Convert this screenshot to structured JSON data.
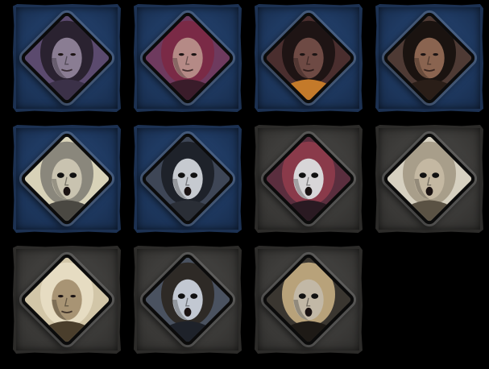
{
  "roster": [
    {
      "name": "character-portrait-1",
      "state": "unlocked",
      "bg": "#5b4a6e",
      "hair": "#2a2230",
      "skin": "#8a7d93",
      "mask": false,
      "accent": "#3b3148",
      "icon": "hooded-woman-icon"
    },
    {
      "name": "character-portrait-2",
      "state": "unlocked",
      "bg": "#6e3a5e",
      "hair": "#7a2a46",
      "skin": "#b58a86",
      "mask": false,
      "accent": "#3a1c2a",
      "icon": "long-hair-man-icon"
    },
    {
      "name": "character-portrait-3",
      "state": "unlocked",
      "bg": "#4a2e2e",
      "hair": "#1e1414",
      "skin": "#6e4a44",
      "mask": false,
      "accent": "#c47a2a",
      "icon": "demon-man-icon"
    },
    {
      "name": "character-portrait-4",
      "state": "unlocked",
      "bg": "#4e3a34",
      "hair": "#1a1310",
      "skin": "#8a6450",
      "mask": false,
      "accent": "#2a1e18",
      "icon": "bearded-brute-icon"
    },
    {
      "name": "character-portrait-5",
      "state": "unlocked",
      "bg": "#d8d2b8",
      "hair": "#8a877c",
      "skin": "#c9c3b0",
      "mask": true,
      "accent": "#4a4842",
      "icon": "screaming-mask-icon"
    },
    {
      "name": "character-portrait-6",
      "state": "unlocked",
      "bg": "#3e4656",
      "hair": "#1e222a",
      "skin": "#c6cad0",
      "mask": true,
      "accent": "#2a2e36",
      "icon": "white-mask-icon"
    },
    {
      "name": "character-portrait-7",
      "state": "locked",
      "bg": "#5a2e3e",
      "hair": "#8a3a4a",
      "skin": "#d8d6d8",
      "mask": true,
      "accent": "#2a1a22",
      "icon": "horror-mask-icon"
    },
    {
      "name": "character-portrait-8",
      "state": "locked",
      "bg": "#d6d0c0",
      "hair": "#a89e8a",
      "skin": "#c4b8a2",
      "mask": true,
      "accent": "#5a5244",
      "icon": "bald-monk-icon"
    },
    {
      "name": "character-portrait-9",
      "state": "locked",
      "bg": "#d2c6a8",
      "hair": "#e6dcc2",
      "skin": "#a89474",
      "mask": false,
      "accent": "#4a3e2c",
      "icon": "pale-hair-woman-icon"
    },
    {
      "name": "character-portrait-10",
      "state": "locked",
      "bg": "#4a5260",
      "hair": "#2e2a26",
      "skin": "#c2c8d2",
      "mask": true,
      "accent": "#1e222a",
      "icon": "hockey-mask-icon"
    },
    {
      "name": "character-portrait-11",
      "state": "locked",
      "bg": "#3a3630",
      "hair": "#b8a27a",
      "skin": "#c2b8a6",
      "mask": true,
      "accent": "#1e1a16",
      "icon": "straw-hat-icon"
    }
  ]
}
